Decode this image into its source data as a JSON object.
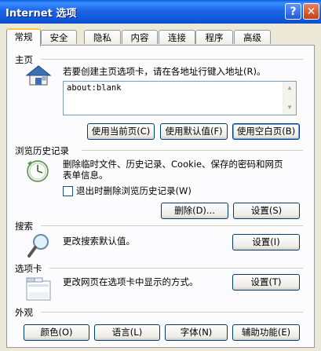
{
  "window": {
    "title": "Internet 选项",
    "help_label": "?",
    "close_label": "✕"
  },
  "tabs": [
    "常规",
    "安全",
    "隐私",
    "内容",
    "连接",
    "程序",
    "高级"
  ],
  "homepage": {
    "group_label": "主页",
    "description": "若要创建主页选项卡，请在各地址行键入地址(R)。",
    "value": "about:blank",
    "buttons": [
      "使用当前页(C)",
      "使用默认值(F)",
      "使用空白页(B)"
    ]
  },
  "history": {
    "group_label": "浏览历史记录",
    "description_line1": "删除临时文件、历史记录、Cookie、保存的密码和网页",
    "description_line2": "表单信息。",
    "checkbox_label": "退出时删除浏览历史记录(W)",
    "checkbox_checked": false,
    "delete_button": "删除(D)...",
    "settings_button": "设置(S)"
  },
  "search": {
    "group_label": "搜索",
    "description": "更改搜索默认值。",
    "settings_button": "设置(I)"
  },
  "tabs_section": {
    "group_label": "选项卡",
    "description": "更改网页在选项卡中显示的方式。",
    "settings_button": "设置(T)"
  },
  "appearance": {
    "group_label": "外观",
    "buttons": [
      "颜色(O)",
      "语言(L)",
      "字体(N)",
      "辅助功能(E)"
    ]
  },
  "colors": {
    "titlebar": "#0b4fd0",
    "tab_highlight": "#ffc73c",
    "dialog_bg": "#ece9d8"
  }
}
